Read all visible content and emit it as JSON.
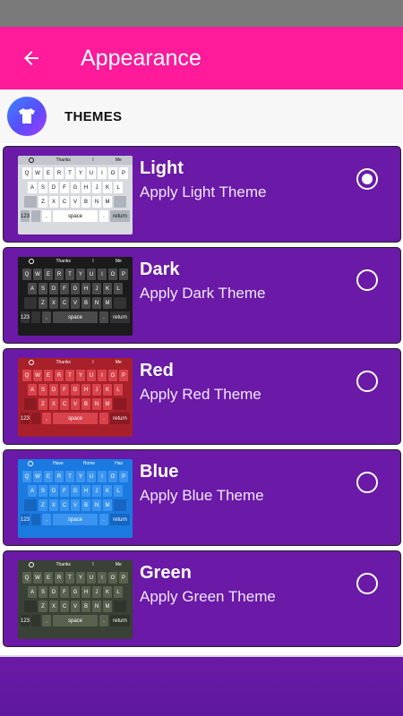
{
  "app_bar": {
    "title": "Appearance",
    "back_icon": "arrow-left-icon"
  },
  "section": {
    "label": "THEMES",
    "icon": "tshirt-icon"
  },
  "keyboard": {
    "row1": [
      "Q",
      "W",
      "E",
      "R",
      "T",
      "Y",
      "U",
      "I",
      "O",
      "P"
    ],
    "row2": [
      "A",
      "S",
      "D",
      "F",
      "G",
      "H",
      "J",
      "K",
      "L"
    ],
    "row3": [
      "Z",
      "X",
      "C",
      "V",
      "B",
      "N",
      "M"
    ],
    "space_label": "space",
    "return_label": "return",
    "num_label": "123",
    "comma_label": ",",
    "period_label": "."
  },
  "themes": [
    {
      "title": "Light",
      "subtitle": "Apply Light Theme",
      "selected": true,
      "suggestions": [
        "Thanks",
        "I",
        "Me"
      ],
      "colors": {
        "bg": "#d8dae0",
        "key": "#ffffff",
        "text": "#111111",
        "top": "#c3c6cc",
        "special": "#aeb3bc"
      }
    },
    {
      "title": "Dark",
      "subtitle": "Apply Dark Theme",
      "selected": false,
      "suggestions": [
        "Thanks",
        "I",
        "Me"
      ],
      "colors": {
        "bg": "#1b1b1b",
        "key": "#4a4a4a",
        "text": "#ffffff",
        "top": "#1b1b1b",
        "special": "#333333"
      }
    },
    {
      "title": "Red",
      "subtitle": "Apply Red Theme",
      "selected": false,
      "suggestions": [
        "Thanks",
        "I",
        "Me"
      ],
      "colors": {
        "bg": "#a7202a",
        "key": "#d9434c",
        "text": "#ffffff",
        "top": "#a7202a",
        "special": "#8b1a22"
      }
    },
    {
      "title": "Blue",
      "subtitle": "Apply Blue Theme",
      "selected": false,
      "suggestions": [
        "Have",
        "Home",
        "Has"
      ],
      "colors": {
        "bg": "#1a7ae0",
        "key": "#3b95f0",
        "text": "#ffffff",
        "top": "#1a7ae0",
        "special": "#1666c0"
      }
    },
    {
      "title": "Green",
      "subtitle": "Apply Green Theme",
      "selected": false,
      "suggestions": [
        "Thanks",
        "I",
        "Me"
      ],
      "colors": {
        "bg": "#3a4136",
        "key": "#59614f",
        "text": "#ffffff",
        "top": "#3a4136",
        "special": "#2f352c"
      }
    }
  ]
}
